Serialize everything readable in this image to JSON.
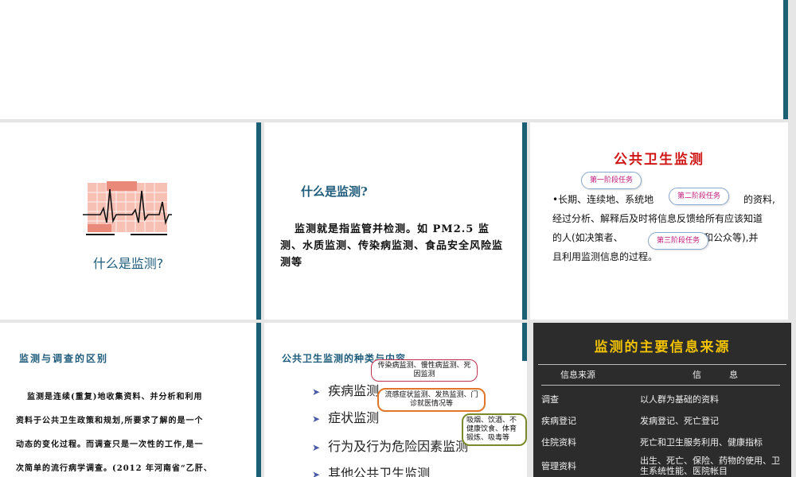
{
  "slide_a": {
    "title": "什么是监测?"
  },
  "slide_b": {
    "title": "什么是监测?",
    "body": "监测就是指监管并检测。如 PM2.5 监测、水质监测、传染病监测、食品安全风险监测等"
  },
  "slide_c": {
    "title": "公共卫生监测",
    "tag1": "第一阶段任务",
    "tag2": "第二阶段任务",
    "tag3": "第三阶段任务",
    "line1a": "•长期、连续地、系统地",
    "line1b": "的资料,",
    "line2": "经过分析、解释后及时将信息反馈给所有应该知道",
    "line3a": "的人(如决策者、",
    "line3b": "和公众等),并",
    "line4": "且利用监测信息的过程。"
  },
  "slide_d": {
    "title": "监测与调查的区别",
    "l1": "监测是连续(重复)地收集资料、并分析和利用",
    "l2": "资料于公共卫生政策和规划,所要求了解的是一个",
    "l3": "动态的变化过程。而调查只是一次性的工作,是一",
    "l4": "次简单的流行病学调查。(2012 年河南省“乙肝、"
  },
  "slide_e": {
    "title": "公共卫生监测的种类与内容",
    "items": [
      "疾病监测",
      "症状监测",
      "行为及行为危险因素监测",
      "其他公共卫生监测"
    ],
    "callout1": "传染病监测、慢性病监测、死因监测",
    "callout2": "流感症状监测、发热监测、门诊就医情况等",
    "callout3": "吸烟、饮酒、不健康饮食、体育锻炼、吸毒等"
  },
  "slide_f": {
    "title": "监测的主要信息来源",
    "headers": [
      "信息来源",
      "信          息"
    ],
    "rows": [
      [
        "调查",
        "以人群为基础的资料"
      ],
      [
        "疾病登记",
        "发病登记、死亡登记"
      ],
      [
        "住院资料",
        "死亡和卫生服务利用、健康指标"
      ],
      [
        "管理资料",
        "出生、死亡、保险、药物的使用、卫生系统性能、医院帐目"
      ]
    ]
  }
}
